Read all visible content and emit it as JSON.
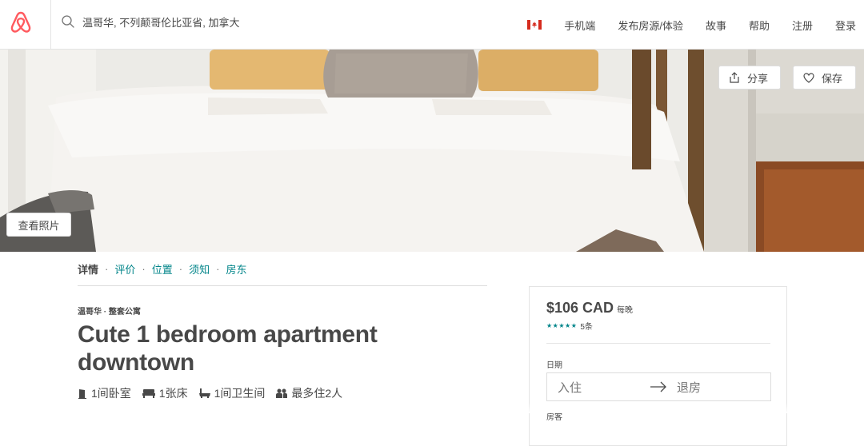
{
  "header": {
    "logo_icon": "airbnb-belo-icon",
    "brand_color": "#FF5A5F",
    "search": {
      "icon": "search-icon",
      "value": "温哥华, 不列颠哥伦比亚省, 加拿大"
    },
    "flag_icon": "canada-flag-icon",
    "nav": [
      "手机端",
      "发布房源/体验",
      "故事",
      "帮助",
      "注册",
      "登录"
    ]
  },
  "hero": {
    "share_label": "分享",
    "save_label": "保存",
    "photos_label": "查看照片"
  },
  "subnav": {
    "items": [
      "详情",
      "评价",
      "位置",
      "须知",
      "房东"
    ],
    "separator": "·",
    "link_color": "#008489"
  },
  "listing": {
    "kicker": "温哥华 · 整套公寓",
    "title": "Cute 1 bedroom apartment downtown",
    "facts": {
      "bedrooms": "1间卧室",
      "beds": "1张床",
      "bathrooms": "1间卫生间",
      "guests": "最多住2人"
    }
  },
  "booking": {
    "price": "$106 CAD",
    "per": "每晚",
    "stars": "★★★★★",
    "reviews": "5条",
    "dates_label": "日期",
    "checkin_placeholder": "入住",
    "checkout_placeholder": "退房",
    "guests_label": "房客"
  }
}
